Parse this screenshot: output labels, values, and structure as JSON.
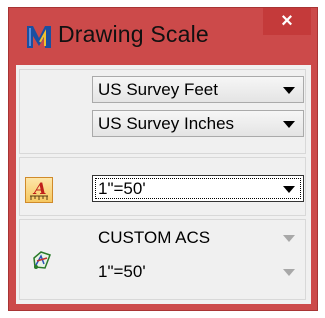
{
  "window": {
    "title": "Drawing Scale",
    "close_label": "×",
    "accent_color": "#cc4a4a"
  },
  "units": {
    "master_unit": "US Survey Feet",
    "sub_unit": "US Survey Inches"
  },
  "scale": {
    "icon": "annotation-scale-icon",
    "value": "1\"=50'"
  },
  "acs": {
    "icon": "custom-acs-icon",
    "name": "CUSTOM ACS",
    "scale": "1\"=50'"
  }
}
